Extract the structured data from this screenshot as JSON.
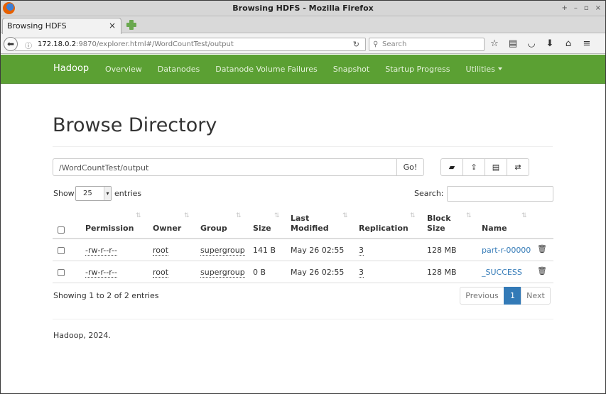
{
  "window": {
    "title": "Browsing HDFS - Mozilla Firefox",
    "controls": [
      "+",
      "–",
      "▫",
      "×"
    ]
  },
  "tabs": [
    {
      "label": "Browsing HDFS",
      "close": "×"
    }
  ],
  "navbar": {
    "url_host": "172.18.0.2",
    "url_rest": ":9870/explorer.html#/WordCountTest/output",
    "search_placeholder": "Search",
    "toolbar_icons": [
      "star-icon",
      "reading-list-icon",
      "pocket-icon",
      "download-icon",
      "home-icon",
      "menu-icon"
    ]
  },
  "app_nav": {
    "brand": "Hadoop",
    "links": [
      "Overview",
      "Datanodes",
      "Datanode Volume Failures",
      "Snapshot",
      "Startup Progress",
      "Utilities"
    ]
  },
  "main": {
    "heading": "Browse Directory",
    "path_value": "/WordCountTest/output",
    "go_label": "Go!",
    "action_icons": [
      "folder-open-icon",
      "upload-icon",
      "list-icon",
      "cut-paste-icon"
    ],
    "show_label": "Show",
    "entries_value": "25",
    "entries_label": "entries",
    "search_label": "Search:",
    "columns": [
      "Permission",
      "Owner",
      "Group",
      "Size",
      "Last Modified",
      "Replication",
      "Block Size",
      "Name"
    ],
    "rows": [
      {
        "permission": "-rw-r--r--",
        "owner": "root",
        "group": "supergroup",
        "size": "141 B",
        "modified": "May 26 02:55",
        "replication": "3",
        "block_size": "128 MB",
        "name": "part-r-00000"
      },
      {
        "permission": "-rw-r--r--",
        "owner": "root",
        "group": "supergroup",
        "size": "0 B",
        "modified": "May 26 02:55",
        "replication": "3",
        "block_size": "128 MB",
        "name": "_SUCCESS"
      }
    ],
    "info": "Showing 1 to 2 of 2 entries",
    "pagination": {
      "previous": "Previous",
      "current": "1",
      "next": "Next"
    }
  },
  "footer": "Hadoop, 2024."
}
